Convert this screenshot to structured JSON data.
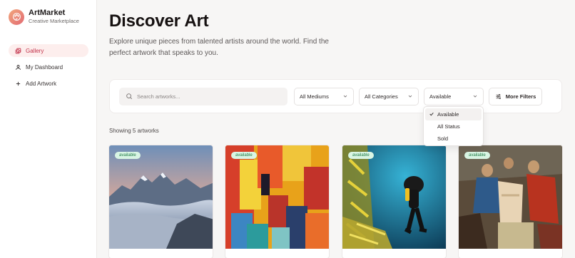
{
  "brand": {
    "title": "ArtMarket",
    "subtitle": "Creative Marketplace",
    "logo_icon": "palette-icon",
    "accent": "#e26a73"
  },
  "sidebar": {
    "items": [
      {
        "label": "Gallery",
        "icon": "gallery-icon",
        "active": true
      },
      {
        "label": "My Dashboard",
        "icon": "user-icon",
        "active": false
      },
      {
        "label": "Add Artwork",
        "icon": "plus-icon",
        "active": false
      }
    ]
  },
  "header": {
    "title": "Discover Art",
    "subtitle": "Explore unique pieces from talented artists around the world. Find the perfect artwork that speaks to you."
  },
  "filters": {
    "search_placeholder": "Search artworks...",
    "medium": "All Mediums",
    "category": "All Categories",
    "status": "Available",
    "more_label": "More Filters",
    "status_options": [
      {
        "label": "Available",
        "selected": true
      },
      {
        "label": "All Status",
        "selected": false
      },
      {
        "label": "Sold",
        "selected": false
      }
    ]
  },
  "results": {
    "count_text": "Showing 5 artworks"
  },
  "artworks": [
    {
      "badge": "available",
      "scene": "mountain-sea-of-clouds"
    },
    {
      "badge": "available",
      "scene": "abstract-colorful-painting"
    },
    {
      "badge": "available",
      "scene": "scuba-diver-fish"
    },
    {
      "badge": "available",
      "scene": "classical-religious-painting"
    }
  ],
  "colors": {
    "badge_bg": "#d9f5e4",
    "badge_text": "#1f7a45",
    "active_nav_bg": "#fdeeed",
    "active_nav_text": "#c2334b"
  }
}
